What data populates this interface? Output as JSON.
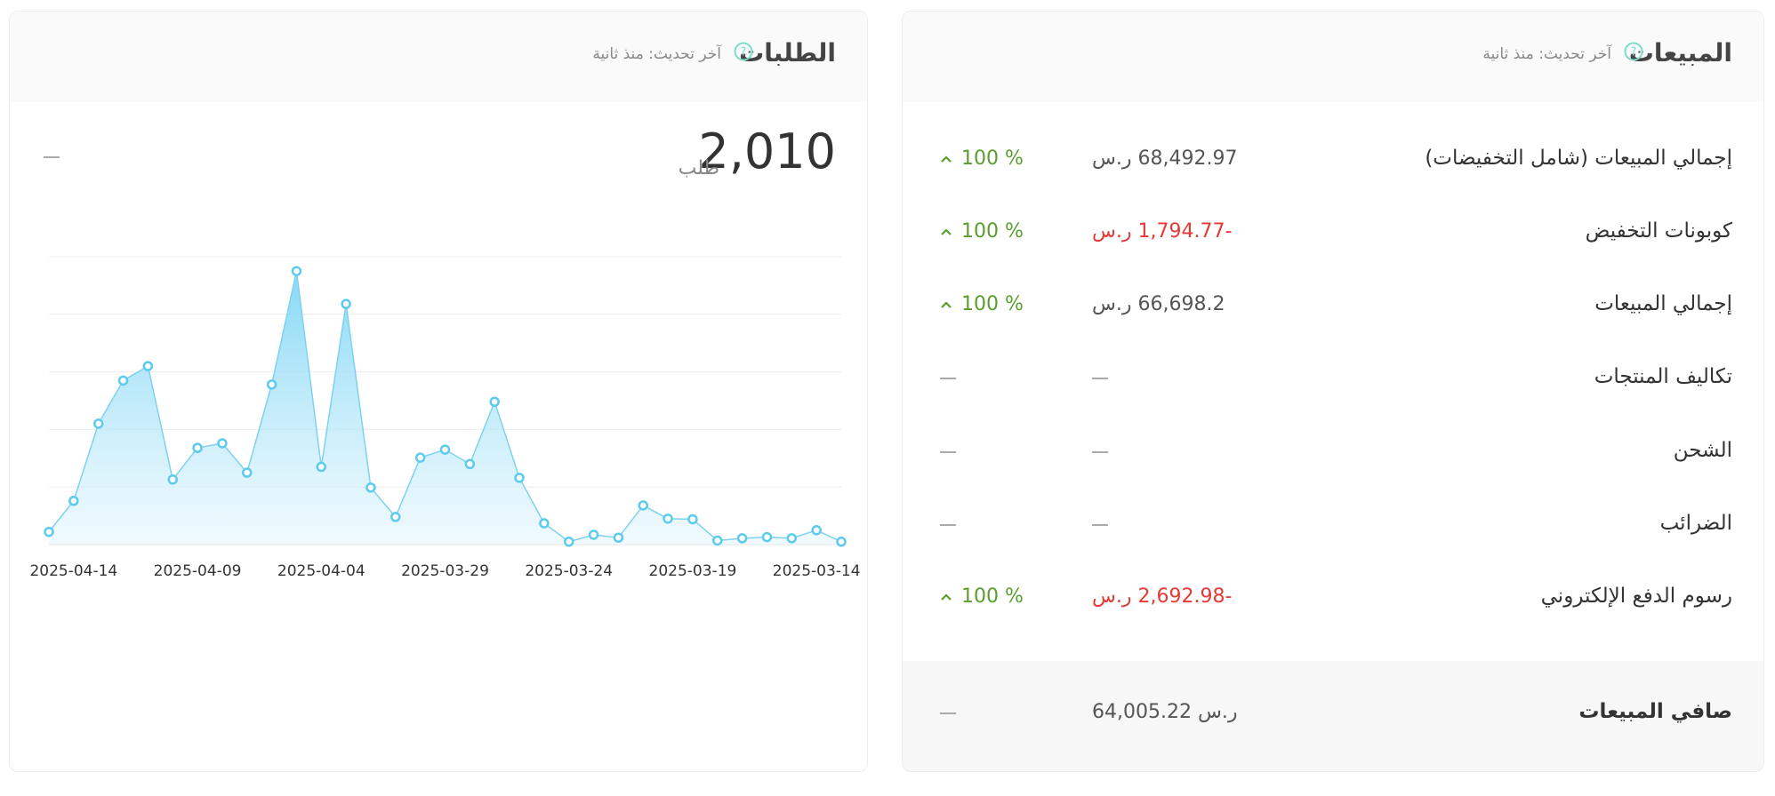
{
  "orders": {
    "title": "الطلبات",
    "updated": "آخر تحديث: منذ ثانية",
    "total": "2,010",
    "unit": "طلب",
    "change": "—"
  },
  "sales": {
    "title": "المبيعات",
    "updated": "آخر تحديث: منذ ثانية",
    "rows": [
      {
        "label": "إجمالي المبيعات (شامل التخفيضات)",
        "value": "68,492.97 ر.س",
        "negative": false,
        "change": "100 %",
        "trend": "up"
      },
      {
        "label": "كوبونات التخفيض",
        "value": "-1,794.77 ر.س",
        "negative": true,
        "change": "100 %",
        "trend": "up"
      },
      {
        "label": "إجمالي المبيعات",
        "value": "66,698.2 ر.س",
        "negative": false,
        "change": "100 %",
        "trend": "up"
      },
      {
        "label": "تكاليف المنتجات",
        "value": null,
        "negative": false,
        "change": null,
        "trend": null
      },
      {
        "label": "الشحن",
        "value": null,
        "negative": false,
        "change": null,
        "trend": null
      },
      {
        "label": "الضرائب",
        "value": null,
        "negative": false,
        "change": null,
        "trend": null
      },
      {
        "label": "رسوم الدفع الإلكتروني",
        "value": "-2,692.98 ر.س",
        "negative": true,
        "change": "100 %",
        "trend": "up"
      }
    ],
    "net": {
      "label": "صافي المبيعات",
      "value": "64,005.22 ر.س",
      "change": null
    }
  },
  "colors": {
    "positive": "#5a9e2e",
    "negative": "#e53935",
    "chart_line": "#7fd1ef",
    "help_icon": "#7ddcc8"
  },
  "chart_data": {
    "type": "area",
    "x": [
      "2025-04-15",
      "2025-04-14",
      "2025-04-13",
      "2025-04-12",
      "2025-04-11",
      "2025-04-10",
      "2025-04-09",
      "2025-04-08",
      "2025-04-07",
      "2025-04-06",
      "2025-04-05",
      "2025-04-04",
      "2025-04-03",
      "2025-04-02",
      "2025-04-01",
      "2025-03-31",
      "2025-03-30",
      "2025-03-29",
      "2025-03-28",
      "2025-03-27",
      "2025-03-26",
      "2025-03-25",
      "2025-03-24",
      "2025-03-23",
      "2025-03-22",
      "2025-03-21",
      "2025-03-20",
      "2025-03-19",
      "2025-03-18",
      "2025-03-17",
      "2025-03-16",
      "2025-03-15",
      "2025-03-14",
      "2025-03-13",
      "2025-03-12"
    ],
    "values": [
      22,
      76,
      210,
      285,
      310,
      113,
      168,
      176,
      125,
      278,
      475,
      135,
      418,
      99,
      48,
      151,
      165,
      140,
      248,
      116,
      37,
      5,
      17,
      12,
      68,
      45,
      44,
      7,
      11,
      13,
      11,
      25,
      5
    ],
    "x_tick_labels": [
      "2025-04-14",
      "2025-04-09",
      "2025-04-04",
      "2025-03-29",
      "2025-03-24",
      "2025-03-19",
      "2025-03-14"
    ],
    "ylim": [
      0,
      500
    ],
    "grid": true,
    "x_reversed": true
  }
}
